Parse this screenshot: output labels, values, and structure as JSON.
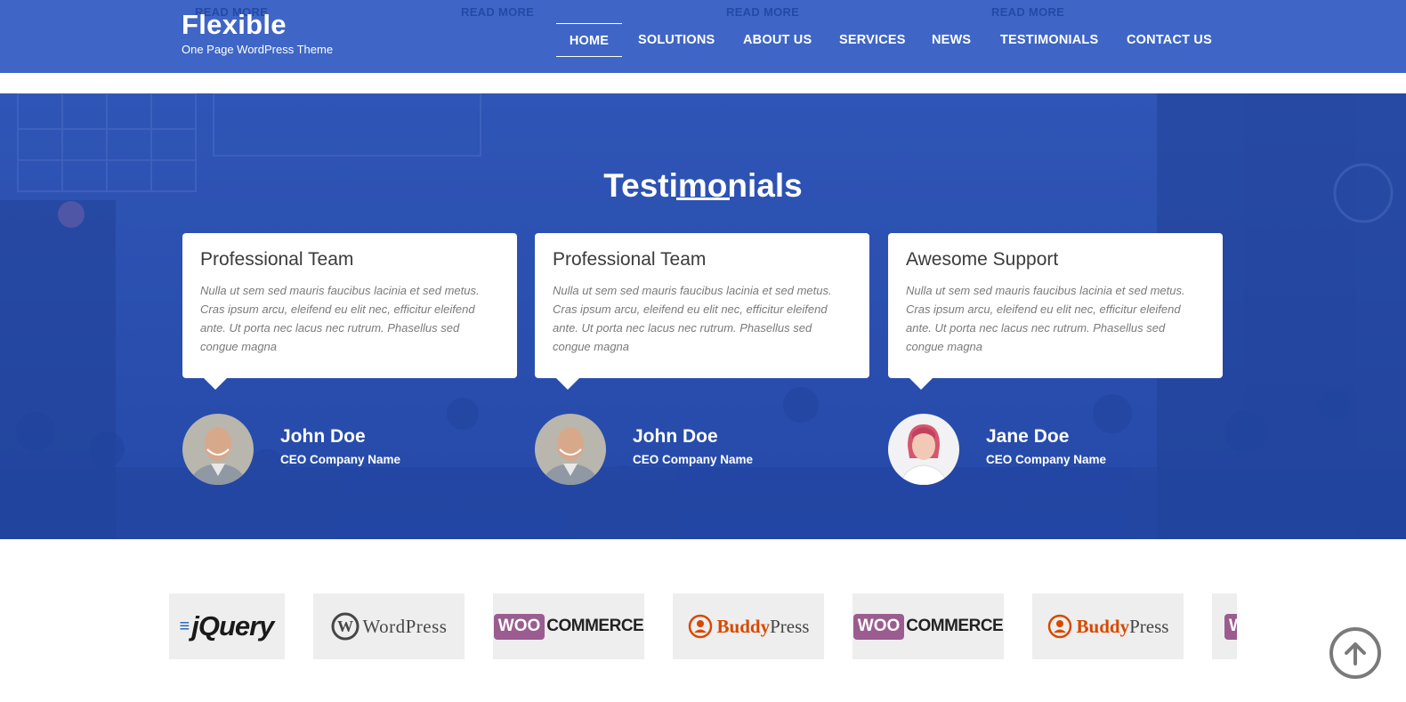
{
  "header": {
    "brand_title": "Flexible",
    "brand_tagline": "One Page WordPress Theme",
    "read_more_links": [
      "READ MORE",
      "READ MORE",
      "READ MORE",
      "READ MORE"
    ],
    "nav": [
      {
        "label": "HOME",
        "active": true
      },
      {
        "label": "SOLUTIONS",
        "active": false
      },
      {
        "label": "ABOUT US",
        "active": false
      },
      {
        "label": "SERVICES",
        "active": false
      },
      {
        "label": "NEWS",
        "active": false
      },
      {
        "label": "TESTIMONIALS",
        "active": false
      },
      {
        "label": "CONTACT US",
        "active": false
      }
    ]
  },
  "testimonials": {
    "title": "Testimonials",
    "items": [
      {
        "heading": "Professional Team",
        "text": "Nulla ut sem sed mauris faucibus lacinia et sed metus. Cras ipsum arcu, eleifend eu elit nec, efficitur eleifend ante. Ut porta nec lacus nec rutrum. Phasellus sed congue magna",
        "name": "John Doe",
        "role": "CEO Company Name"
      },
      {
        "heading": "Professional Team",
        "text": "Nulla ut sem sed mauris faucibus lacinia et sed metus. Cras ipsum arcu, eleifend eu elit nec, efficitur eleifend ante. Ut porta nec lacus nec rutrum. Phasellus sed congue magna",
        "name": "John Doe",
        "role": "CEO Company Name"
      },
      {
        "heading": "Awesome Support",
        "text": "Nulla ut sem sed mauris faucibus lacinia et sed metus. Cras ipsum arcu, eleifend eu elit nec, efficitur eleifend ante. Ut porta nec lacus nec rutrum. Phasellus sed congue magna",
        "name": "Jane Doe",
        "role": "CEO Company Name"
      }
    ]
  },
  "logos": {
    "jquery": "jQuery",
    "wordpress": "WordPress",
    "woo_badge": "WOO",
    "woo_text": "COMMERCE",
    "buddy": "Buddy",
    "press": "Press"
  },
  "icons": {
    "back_to_top": "arrow-up-circle-icon",
    "wordpress": "wordpress-icon",
    "buddypress": "buddypress-icon"
  },
  "colors": {
    "header_bg": "#3f66c6",
    "band_bg": "#2a4fb1",
    "woo_purple": "#9b5c8f",
    "buddy_orange": "#d84800"
  }
}
